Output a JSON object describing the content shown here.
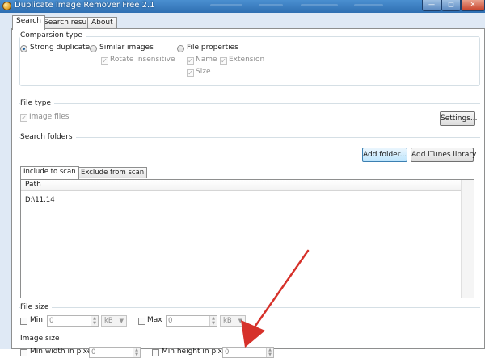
{
  "window": {
    "title": "Duplicate Image Remover Free 2.1"
  },
  "tabs": [
    "Search",
    "Search result",
    "About"
  ],
  "comparison": {
    "title": "Comparsion type",
    "strong": "Strong duplicate",
    "similar": "Similar images",
    "rotate": "Rotate insensitive",
    "fileprops": "File properties",
    "name": "Name",
    "extension": "Extension",
    "size": "Size"
  },
  "filetype": {
    "title": "File type",
    "image_files": "Image files",
    "settings_button": "Settings..."
  },
  "folders": {
    "title": "Search folders",
    "add_folder": "Add folder...",
    "add_itunes": "Add iTunes library",
    "tab_include": "Include to scan",
    "tab_exclude": "Exclude from scan",
    "column_path": "Path",
    "rows": [
      "D:\\11.14"
    ]
  },
  "filesize": {
    "title": "File size",
    "min_label": "Min",
    "min_value": "0",
    "min_unit": "kB",
    "max_label": "Max",
    "max_value": "0",
    "max_unit": "kB"
  },
  "imagesize": {
    "title": "Image size",
    "min_width_label": "Min width in pixel",
    "min_width_value": "0",
    "min_height_label": "Min height in pixel",
    "min_height_value": "0"
  },
  "colors": {
    "title_bar": "#2f6fb2",
    "frame": "#dfe9f5",
    "annotation_arrow": "#d6312a"
  }
}
